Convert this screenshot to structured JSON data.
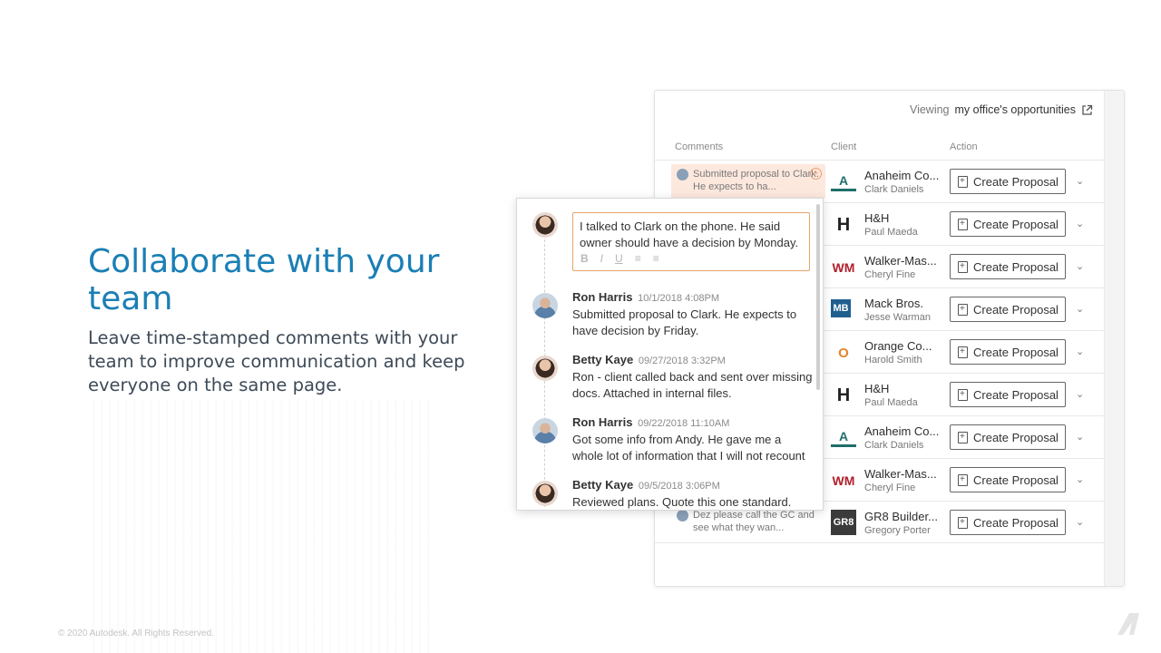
{
  "hero": {
    "title": "Collaborate with your team",
    "subtitle": "Leave time-stamped comments with your team to improve communication and keep everyone on the same page."
  },
  "footer": {
    "copyright": "© 2020 Autodesk. All Rights Reserved."
  },
  "panel": {
    "viewing_prefix": "Viewing",
    "viewing_scope": "my office's opportunities",
    "columns": {
      "comments": "Comments",
      "client": "Client",
      "action": "Action"
    },
    "rows": [
      {
        "comment": "Submitted proposal to Clark. He expects to ha...",
        "client": "Anaheim Co...",
        "contact": "Clark Daniels",
        "logo": "A",
        "action": "Create Proposal"
      },
      {
        "comment": "",
        "client": "H&H",
        "contact": "Paul Maeda",
        "logo": "H",
        "action": "Create Proposal"
      },
      {
        "comment": "",
        "client": "Walker-Mas...",
        "contact": "Cheryl Fine",
        "logo": "WM",
        "action": "Create Proposal"
      },
      {
        "comment": "",
        "client": "Mack Bros.",
        "contact": "Jesse Warman",
        "logo": "MB",
        "action": "Create Proposal"
      },
      {
        "comment": "",
        "client": "Orange Co...",
        "contact": "Harold Smith",
        "logo": "O",
        "action": "Create Proposal"
      },
      {
        "comment": "",
        "client": "H&H",
        "contact": "Paul Maeda",
        "logo": "H",
        "action": "Create Proposal"
      },
      {
        "comment": "",
        "client": "Anaheim Co...",
        "contact": "Clark Daniels",
        "logo": "A",
        "action": "Create Proposal"
      },
      {
        "comment": "",
        "client": "Walker-Mas...",
        "contact": "Cheryl Fine",
        "logo": "WM",
        "action": "Create Proposal"
      },
      {
        "comment": "Dez please call the GC and see what they wan...",
        "client": "GR8 Builder...",
        "contact": "Gregory Porter",
        "logo": "GR8",
        "action": "Create Proposal"
      }
    ]
  },
  "popover": {
    "draft": "I talked to Clark on the phone. He said owner should have a decision by Monday.",
    "toolbar": {
      "bold": "B",
      "italic": "I",
      "underline": "U"
    },
    "comments": [
      {
        "author": "Ron Harris",
        "time": "10/1/2018 4:08PM",
        "text": "Submitted proposal to Clark. He expects to have decision by Friday."
      },
      {
        "author": "Betty Kaye",
        "time": "09/27/2018 3:32PM",
        "text": "Ron - client called back and sent over missing docs. Attached in internal files."
      },
      {
        "author": "Ron Harris",
        "time": "09/22/2018 11:10AM",
        "text": "Got some info from Andy. He gave me a whole lot of information that I will not recount"
      },
      {
        "author": "Betty Kaye",
        "time": "09/5/2018 3:06PM",
        "text": "Reviewed plans. Quote this one standard."
      }
    ]
  },
  "colors": {
    "brand_blue": "#1a7fb5",
    "accent_orange": "#e6a46a",
    "highlight_row": "#fde8de"
  }
}
